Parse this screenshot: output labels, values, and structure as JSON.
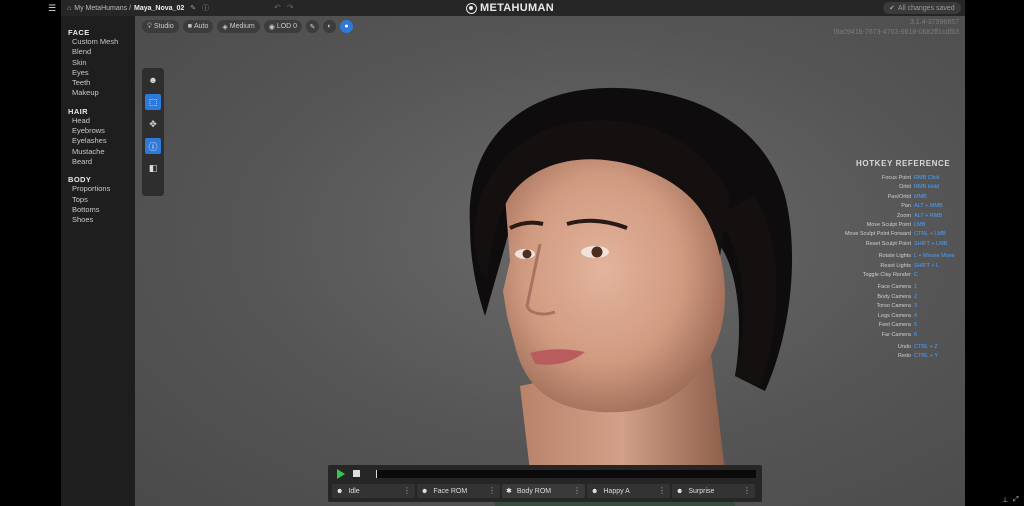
{
  "topbar": {
    "breadcrumb_root": "My MetaHumans /",
    "breadcrumb_current": "Maya_Nova_02",
    "logo_text": "METAHUMAN",
    "saved_status": "All changes saved"
  },
  "sidebar": {
    "sections": [
      {
        "title": "FACE",
        "items": [
          "Custom Mesh",
          "Blend",
          "Skin",
          "Eyes",
          "Teeth",
          "Makeup"
        ]
      },
      {
        "title": "HAIR",
        "items": [
          "Head",
          "Eyebrows",
          "Eyelashes",
          "Mustache",
          "Beard"
        ]
      },
      {
        "title": "BODY",
        "items": [
          "Proportions",
          "Tops",
          "Bottoms",
          "Shoes"
        ]
      }
    ]
  },
  "toolbar": {
    "studio": "Studio",
    "auto": "Auto",
    "medium": "Medium",
    "lod": "LOD 0"
  },
  "version": {
    "line1": "3.1.4-37996657",
    "line2": "f9a0941b-7673-4763-9618-0682ff1cdfb3"
  },
  "hotkeys": {
    "title": "HOTKEY REFERENCE",
    "rows": [
      {
        "k": "Focus Point",
        "v": "RMB Click"
      },
      {
        "k": "Orbit",
        "v": "RMB Hold"
      },
      {
        "k": "Pan/Orbit",
        "v": "MMB"
      },
      {
        "k": "Pan",
        "v": "ALT + MMB"
      },
      {
        "k": "Zoom",
        "v": "ALT + RMB"
      },
      {
        "k": "Move Sculpt Point",
        "v": "LMB"
      },
      {
        "k": "Move Sculpt Point Forward",
        "v": "CTRL + LMB"
      },
      {
        "k": "Reset Sculpt Point",
        "v": "SHIFT + LMB"
      },
      {
        "k": "",
        "v": ""
      },
      {
        "k": "Rotate Lights",
        "v": "L + Mouse Move"
      },
      {
        "k": "Reset Lights",
        "v": "SHIFT + L"
      },
      {
        "k": "Toggle Clay Render",
        "v": "C"
      },
      {
        "k": "",
        "v": ""
      },
      {
        "k": "Face Camera",
        "v": "1"
      },
      {
        "k": "Body Camera",
        "v": "2"
      },
      {
        "k": "Torso Camera",
        "v": "3"
      },
      {
        "k": "Legs Camera",
        "v": "4"
      },
      {
        "k": "Feet Camera",
        "v": "5"
      },
      {
        "k": "Far Camera",
        "v": "6"
      },
      {
        "k": "",
        "v": ""
      },
      {
        "k": "Undo",
        "v": "CTRL + Z"
      },
      {
        "k": "Redo",
        "v": "CTRL + Y"
      }
    ]
  },
  "player": {
    "animations": [
      {
        "label": "Idle",
        "icon": "face-icon"
      },
      {
        "label": "Face ROM",
        "icon": "face-icon"
      },
      {
        "label": "Body ROM",
        "icon": "body-icon"
      },
      {
        "label": "Happy A",
        "icon": "face-icon"
      },
      {
        "label": "Surprise",
        "icon": "face-icon"
      }
    ]
  }
}
